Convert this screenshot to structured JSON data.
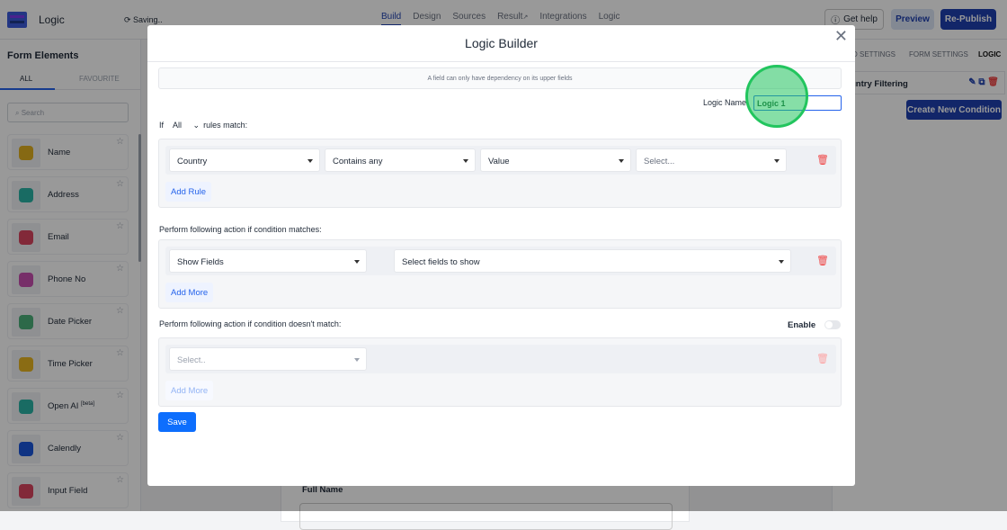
{
  "header": {
    "app_title": "Logic",
    "saving_status": "Saving..",
    "nav_tabs": [
      "Build",
      "Design",
      "Sources",
      "Result",
      "Integrations",
      "Logic"
    ],
    "active_tab": "Build",
    "get_help": "Get help",
    "preview": "Preview",
    "republish": "Re-Publish"
  },
  "sidebar": {
    "title": "Form Elements",
    "tabs": [
      "ALL",
      "FAVOURITE"
    ],
    "search_placeholder": "Search",
    "elements": [
      {
        "label": "Name",
        "color": "#e0b020"
      },
      {
        "label": "Address",
        "color": "#2ab3a6"
      },
      {
        "label": "Email",
        "color": "#d9455f"
      },
      {
        "label": "Phone No",
        "color": "#c74fb0"
      },
      {
        "label": "Date Picker",
        "color": "#4caf7a"
      },
      {
        "label": "Time Picker",
        "color": "#e6b422"
      },
      {
        "label": "Open AI",
        "badge": "[beta]",
        "color": "#2ab3a6"
      },
      {
        "label": "Calendly",
        "color": "#1a56db"
      },
      {
        "label": "Input Field",
        "color": "#d9455f"
      }
    ]
  },
  "canvas": {
    "field_label": "Full Name"
  },
  "right_panel": {
    "tabs": [
      "D SETTINGS",
      "FORM SETTINGS",
      "LOGIC"
    ],
    "condition_name": "untry Filtering",
    "create_button": "Create New Condition"
  },
  "modal": {
    "title": "Logic Builder",
    "note": "A field can only have dependency on its upper fields",
    "logic_name_label": "Logic Name",
    "logic_name_value": "Logic 1",
    "if_label": "If",
    "match_mode": "All",
    "rules_match": "rules match:",
    "rule": {
      "field": "Country",
      "operator": "Contains any",
      "type": "Value",
      "value_placeholder": "Select..."
    },
    "add_rule": "Add Rule",
    "match_section_label": "Perform following action if condition matches:",
    "match_action": {
      "action": "Show Fields",
      "fields_placeholder": "Select fields to show"
    },
    "add_more": "Add More",
    "nomatch_section_label": "Perform following action if condition doesn't match:",
    "enable_label": "Enable",
    "enable_on": false,
    "nomatch_action": {
      "placeholder": "Select.."
    },
    "save": "Save"
  },
  "colors": {
    "primary": "#1e40af",
    "save": "#0d6efd",
    "highlight": "#22c55e",
    "danger": "#ef4444"
  }
}
